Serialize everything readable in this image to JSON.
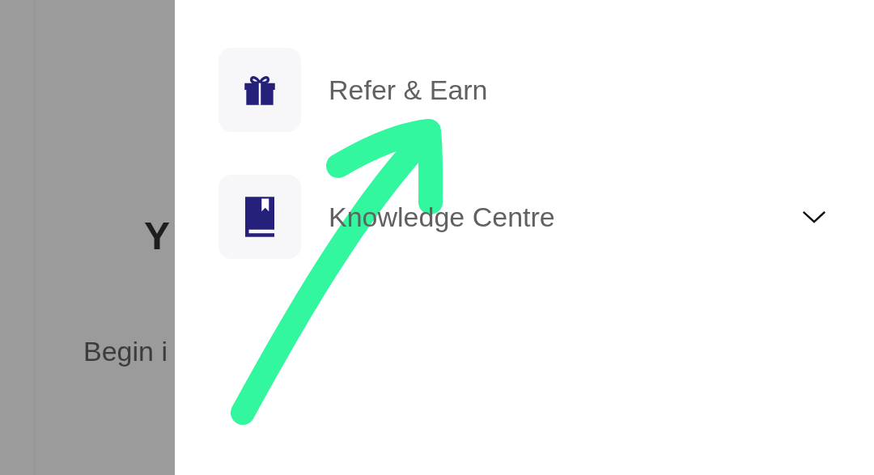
{
  "background": {
    "title": "Y",
    "subtitle": "Begin i"
  },
  "drawer": {
    "items": [
      {
        "label": "Refer & Earn",
        "kind": "link"
      },
      {
        "label": "Knowledge Centre",
        "kind": "group",
        "expanded": false
      }
    ]
  }
}
